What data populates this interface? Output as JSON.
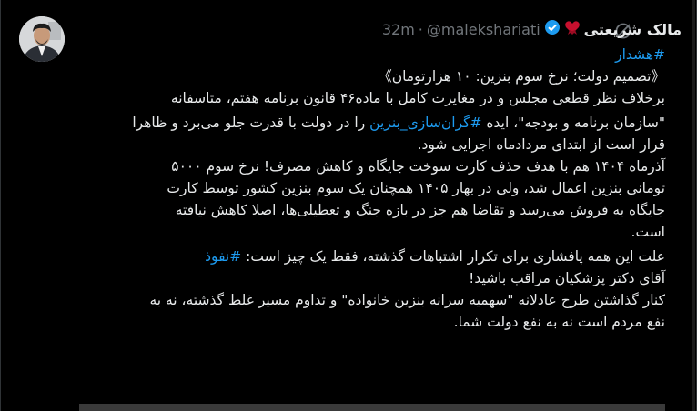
{
  "author": {
    "display_name": "مالک شریعتی",
    "handle": "@malekshariati",
    "separator": "·",
    "time": "32m",
    "verified_icon": "verified-badge-icon",
    "emoji_icon": "heart-ribbon-icon"
  },
  "grok_icon": "grok-icon",
  "tweet": {
    "line1": "#هشدار",
    "line2": "《تصمیم دولت؛ نرخ سوم بنزین: ۱۰ هزارتومان》",
    "line3": "برخلاف نظر قطعی مجلس و در مغایرت کامل با ماده۴۶ قانون برنامه هفتم، متاسفانه",
    "line4_a": "\"سازمان برنامه و بودجه\"، ایده ",
    "line4_link": "#گران‌سازی_بنزین",
    "line4_b": " را در دولت با قدرت جلو می‌برد و ظاهرا",
    "line5": "قرار است از ابتدای مردادماه اجرایی شود.",
    "line6": "آذرماه ۱۴۰۴ هم با هدف حذف کارت سوخت جایگاه و کاهش مصرف! نرخ سوم ۵۰۰۰",
    "line7": "تومانی بنزین اعمال شد، ولی در بهار ۱۴۰۵ همچنان یک سوم بنزین کشور توسط کارت",
    "line8": "جایگاه به فروش می‌رسد و تقاضا هم جز در بازه جنگ و تعطیلی‌ها، اصلا کاهش نیافته",
    "line9": "است.",
    "line10_a": "علت این همه پافشاری برای تکرار اشتباهات گذشته، فقط یک چیز است: ",
    "line10_link": "#نفوذ",
    "line11": "آقای دکتر پزشکیان مراقب باشید!",
    "line12": "کنار گذاشتن طرح عادلانه \"سهمیه سرانه بنزین خانواده\" و تداوم مسیر غلط گذشته، نه به",
    "line13": "نفع مردم است نه به نفع دولت شما."
  },
  "colors": {
    "background": "#000000",
    "text": "#e7e9ea",
    "muted": "#71767b",
    "link": "#1d9bf0",
    "verified": "#1d9bf0",
    "emoji": "#c8102e"
  }
}
